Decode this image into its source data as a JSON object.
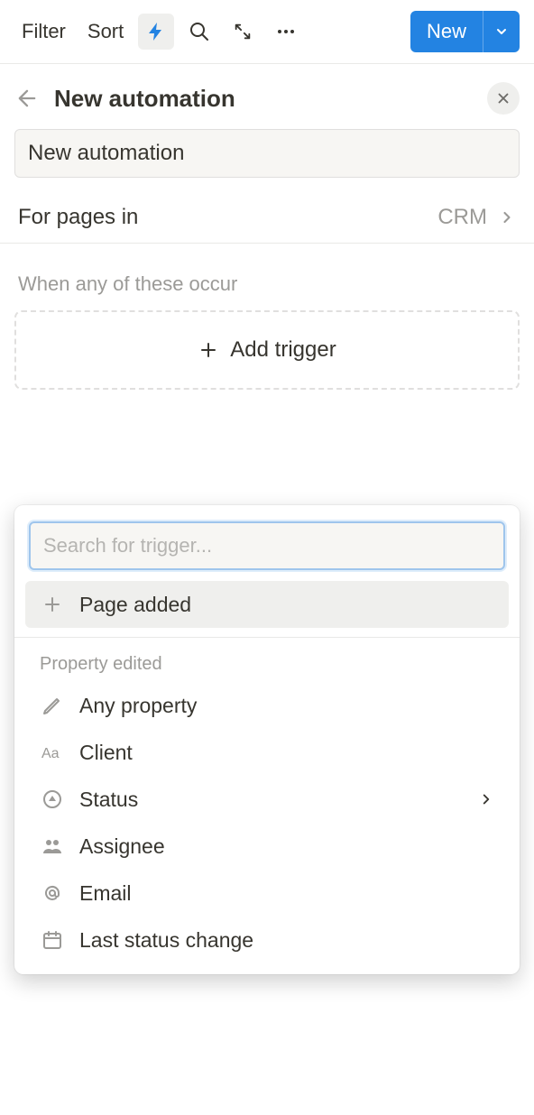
{
  "toolbar": {
    "filter": "Filter",
    "sort": "Sort",
    "new_button": "New"
  },
  "header": {
    "title": "New automation"
  },
  "name_input": {
    "value": "New automation"
  },
  "for_pages": {
    "label": "For pages in",
    "value": "CRM"
  },
  "trigger_section": {
    "label": "When any of these occur",
    "add_button": "Add trigger"
  },
  "dropdown": {
    "search_placeholder": "Search for trigger...",
    "page_added": "Page added",
    "section_label": "Property edited",
    "items": [
      {
        "label": "Any property"
      },
      {
        "label": "Client"
      },
      {
        "label": "Status"
      },
      {
        "label": "Assignee"
      },
      {
        "label": "Email"
      },
      {
        "label": "Last status change"
      }
    ]
  }
}
